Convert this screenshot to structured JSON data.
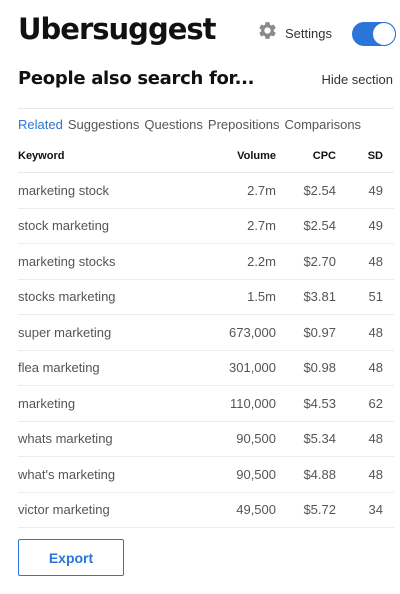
{
  "header": {
    "brand": "Ubersuggest",
    "settings_label": "Settings",
    "toggle_on": true
  },
  "section": {
    "title": "People also search for...",
    "hide_label": "Hide section"
  },
  "tabs": [
    {
      "label": "Related",
      "active": true
    },
    {
      "label": "Suggestions",
      "active": false
    },
    {
      "label": "Questions",
      "active": false
    },
    {
      "label": "Prepositions",
      "active": false
    },
    {
      "label": "Comparisons",
      "active": false
    }
  ],
  "table": {
    "headers": {
      "keyword": "Keyword",
      "volume": "Volume",
      "cpc": "CPC",
      "sd": "SD"
    },
    "rows": [
      {
        "keyword": "marketing stock",
        "volume": "2.7m",
        "cpc": "$2.54",
        "sd": "49"
      },
      {
        "keyword": "stock marketing",
        "volume": "2.7m",
        "cpc": "$2.54",
        "sd": "49"
      },
      {
        "keyword": "marketing stocks",
        "volume": "2.2m",
        "cpc": "$2.70",
        "sd": "48"
      },
      {
        "keyword": "stocks marketing",
        "volume": "1.5m",
        "cpc": "$3.81",
        "sd": "51"
      },
      {
        "keyword": "super marketing",
        "volume": "673,000",
        "cpc": "$0.97",
        "sd": "48"
      },
      {
        "keyword": "flea marketing",
        "volume": "301,000",
        "cpc": "$0.98",
        "sd": "48"
      },
      {
        "keyword": "marketing",
        "volume": "110,000",
        "cpc": "$4.53",
        "sd": "62"
      },
      {
        "keyword": "whats marketing",
        "volume": "90,500",
        "cpc": "$5.34",
        "sd": "48"
      },
      {
        "keyword": "what's marketing",
        "volume": "90,500",
        "cpc": "$4.88",
        "sd": "48"
      },
      {
        "keyword": "victor marketing",
        "volume": "49,500",
        "cpc": "$5.72",
        "sd": "34"
      }
    ]
  },
  "export_label": "Export",
  "colors": {
    "accent": "#2b74d8",
    "icon_gray": "#8a8a8a"
  },
  "icons": {
    "settings": "gear-icon"
  }
}
